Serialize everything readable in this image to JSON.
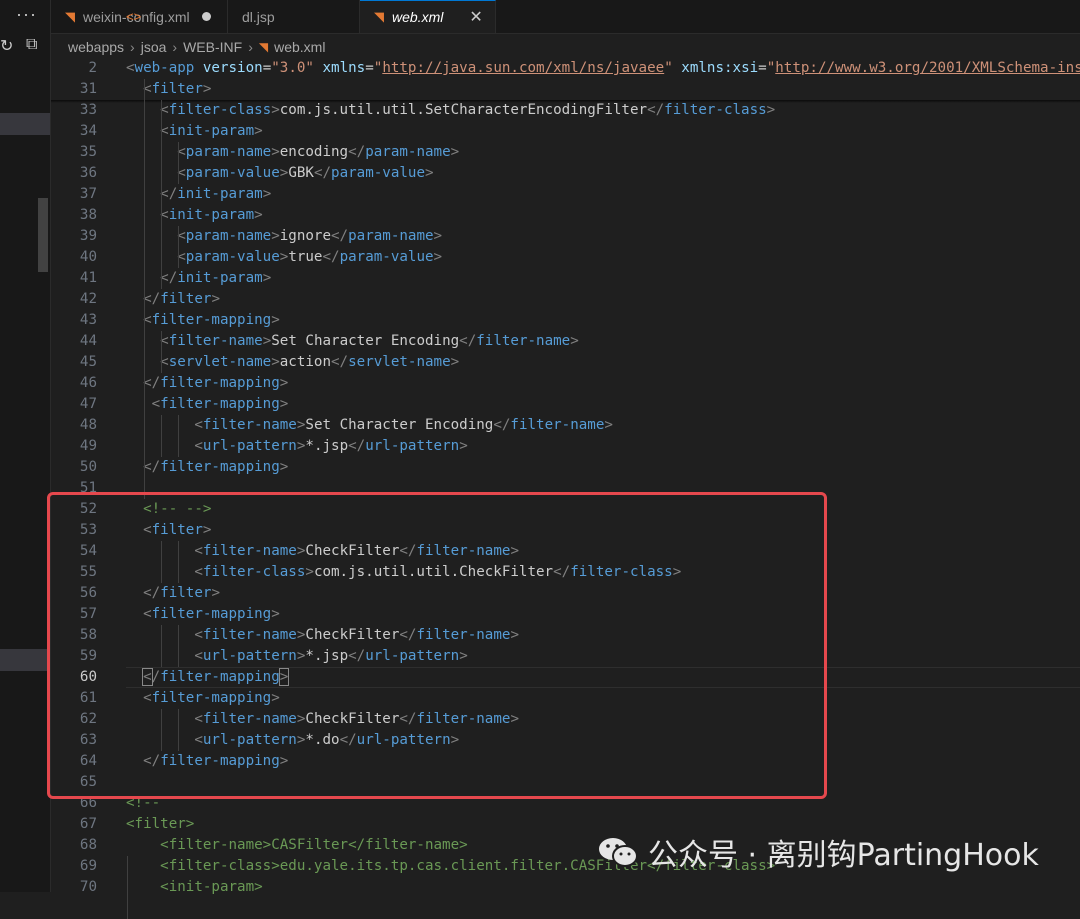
{
  "sidebar": {
    "more_icon": "ellipsis-icon",
    "refresh_icon": "refresh-icon",
    "collapse_icon": "collapse-all-icon"
  },
  "tabs": [
    {
      "label": "weixin-config.xml",
      "icon": "rss-icon",
      "modified": true,
      "active": false
    },
    {
      "label": "dl.jsp",
      "icon": "code-icon",
      "active": false
    },
    {
      "label": "web.xml",
      "icon": "rss-icon",
      "active": true
    }
  ],
  "breadcrumb": [
    "webapps",
    "jsoa",
    "WEB-INF",
    "web.xml"
  ],
  "current_line": "60",
  "watermark": "公众号 · 离别钩PartingHook",
  "lines": [
    {
      "n": "2",
      "html": "<span class='br'>&lt;</span><span class='t'>web-app</span> <span class='at'>version</span><span class='tx'>=</span><span class='st'>\"3.0\"</span> <span class='at'>xmlns</span><span class='tx'>=</span><span class='st'>\"<u>http://java.sun.com/xml/ns/javaee</u>\"</span> <span class='at'>xmlns:xsi</span><span class='tx'>=</span><span class='st'>\"<u>http://www.w3.org/2001/XMLSchema-ins</u></span>"
    },
    {
      "n": "31",
      "html": "  <span class='br'>&lt;</span><span class='t'>filter</span><span class='br'>&gt;</span>"
    },
    {
      "n": "33",
      "html": "    <span class='br'>&lt;</span><span class='t'>filter-class</span><span class='br'>&gt;</span><span class='tx'>com.js.util.util.SetCharacterEncodingFilter</span><span class='br'>&lt;/</span><span class='t'>filter-class</span><span class='br'>&gt;</span>"
    },
    {
      "n": "34",
      "html": "    <span class='br'>&lt;</span><span class='t'>init-param</span><span class='br'>&gt;</span>"
    },
    {
      "n": "35",
      "html": "      <span class='br'>&lt;</span><span class='t'>param-name</span><span class='br'>&gt;</span><span class='tx'>encoding</span><span class='br'>&lt;/</span><span class='t'>param-name</span><span class='br'>&gt;</span>"
    },
    {
      "n": "36",
      "html": "      <span class='br'>&lt;</span><span class='t'>param-value</span><span class='br'>&gt;</span><span class='tx'>GBK</span><span class='br'>&lt;/</span><span class='t'>param-value</span><span class='br'>&gt;</span>"
    },
    {
      "n": "37",
      "html": "    <span class='br'>&lt;/</span><span class='t'>init-param</span><span class='br'>&gt;</span>"
    },
    {
      "n": "38",
      "html": "    <span class='br'>&lt;</span><span class='t'>init-param</span><span class='br'>&gt;</span>"
    },
    {
      "n": "39",
      "html": "      <span class='br'>&lt;</span><span class='t'>param-name</span><span class='br'>&gt;</span><span class='tx'>ignore</span><span class='br'>&lt;/</span><span class='t'>param-name</span><span class='br'>&gt;</span>"
    },
    {
      "n": "40",
      "html": "      <span class='br'>&lt;</span><span class='t'>param-value</span><span class='br'>&gt;</span><span class='tx'>true</span><span class='br'>&lt;/</span><span class='t'>param-value</span><span class='br'>&gt;</span>"
    },
    {
      "n": "41",
      "html": "    <span class='br'>&lt;/</span><span class='t'>init-param</span><span class='br'>&gt;</span>"
    },
    {
      "n": "42",
      "html": "  <span class='br'>&lt;/</span><span class='t'>filter</span><span class='br'>&gt;</span>"
    },
    {
      "n": "43",
      "html": "  <span class='br'>&lt;</span><span class='t'>filter-mapping</span><span class='br'>&gt;</span>"
    },
    {
      "n": "44",
      "html": "    <span class='br'>&lt;</span><span class='t'>filter-name</span><span class='br'>&gt;</span><span class='tx'>Set Character Encoding</span><span class='br'>&lt;/</span><span class='t'>filter-name</span><span class='br'>&gt;</span>"
    },
    {
      "n": "45",
      "html": "    <span class='br'>&lt;</span><span class='t'>servlet-name</span><span class='br'>&gt;</span><span class='tx'>action</span><span class='br'>&lt;/</span><span class='t'>servlet-name</span><span class='br'>&gt;</span>"
    },
    {
      "n": "46",
      "html": "  <span class='br'>&lt;/</span><span class='t'>filter-mapping</span><span class='br'>&gt;</span>"
    },
    {
      "n": "47",
      "html": "   <span class='br'>&lt;</span><span class='t'>filter-mapping</span><span class='br'>&gt;</span>"
    },
    {
      "n": "48",
      "html": "        <span class='br'>&lt;</span><span class='t'>filter-name</span><span class='br'>&gt;</span><span class='tx'>Set Character Encoding</span><span class='br'>&lt;/</span><span class='t'>filter-name</span><span class='br'>&gt;</span>"
    },
    {
      "n": "49",
      "html": "        <span class='br'>&lt;</span><span class='t'>url-pattern</span><span class='br'>&gt;</span><span class='tx'>*.jsp</span><span class='br'>&lt;/</span><span class='t'>url-pattern</span><span class='br'>&gt;</span>"
    },
    {
      "n": "50",
      "html": "  <span class='br'>&lt;/</span><span class='t'>filter-mapping</span><span class='br'>&gt;</span>"
    },
    {
      "n": "51",
      "html": ""
    },
    {
      "n": "52",
      "html": "  <span class='cm'>&lt;!-- --&gt;</span>"
    },
    {
      "n": "53",
      "html": "  <span class='br'>&lt;</span><span class='t'>filter</span><span class='br'>&gt;</span>"
    },
    {
      "n": "54",
      "html": "        <span class='br'>&lt;</span><span class='t'>filter-name</span><span class='br'>&gt;</span><span class='tx'>CheckFilter</span><span class='br'>&lt;/</span><span class='t'>filter-name</span><span class='br'>&gt;</span>"
    },
    {
      "n": "55",
      "html": "        <span class='br'>&lt;</span><span class='t'>filter-class</span><span class='br'>&gt;</span><span class='tx'>com.js.util.util.CheckFilter</span><span class='br'>&lt;/</span><span class='t'>filter-class</span><span class='br'>&gt;</span>"
    },
    {
      "n": "56",
      "html": "  <span class='br'>&lt;/</span><span class='t'>filter</span><span class='br'>&gt;</span>"
    },
    {
      "n": "57",
      "html": "  <span class='br'>&lt;</span><span class='t'>filter-mapping</span><span class='br'>&gt;</span>"
    },
    {
      "n": "58",
      "html": "        <span class='br'>&lt;</span><span class='t'>filter-name</span><span class='br'>&gt;</span><span class='tx'>CheckFilter</span><span class='br'>&lt;/</span><span class='t'>filter-name</span><span class='br'>&gt;</span>"
    },
    {
      "n": "59",
      "html": "        <span class='br'>&lt;</span><span class='t'>url-pattern</span><span class='br'>&gt;</span><span class='tx'>*.jsp</span><span class='br'>&lt;/</span><span class='t'>url-pattern</span><span class='br'>&gt;</span>"
    },
    {
      "n": "60",
      "html": "  <span class='br bracket-box'>&lt;</span><span class='br'>/</span><span class='t'>filter-mapping</span><span class='br bracket-box'>&gt;</span>"
    },
    {
      "n": "61",
      "html": "  <span class='br'>&lt;</span><span class='t'>filter-mapping</span><span class='br'>&gt;</span>"
    },
    {
      "n": "62",
      "html": "        <span class='br'>&lt;</span><span class='t'>filter-name</span><span class='br'>&gt;</span><span class='tx'>CheckFilter</span><span class='br'>&lt;/</span><span class='t'>filter-name</span><span class='br'>&gt;</span>"
    },
    {
      "n": "63",
      "html": "        <span class='br'>&lt;</span><span class='t'>url-pattern</span><span class='br'>&gt;</span><span class='tx'>*.do</span><span class='br'>&lt;/</span><span class='t'>url-pattern</span><span class='br'>&gt;</span>"
    },
    {
      "n": "64",
      "html": "  <span class='br'>&lt;/</span><span class='t'>filter-mapping</span><span class='br'>&gt;</span>"
    },
    {
      "n": "65",
      "html": ""
    },
    {
      "n": "66",
      "html": "<span class='cm'>&lt;!--</span>"
    },
    {
      "n": "67",
      "html": "<span class='cm'>&lt;filter&gt;</span>"
    },
    {
      "n": "68",
      "html": "    <span class='cm'>&lt;filter-name&gt;CASFilter&lt;/filter-name&gt;</span>"
    },
    {
      "n": "69",
      "html": "    <span class='cm'>&lt;filter-class&gt;edu.yale.its.tp.cas.client.filter.CASFilter&lt;/filter-class&gt;</span>"
    },
    {
      "n": "70",
      "html": "    <span class='cm'>&lt;init-param&gt;</span>"
    }
  ]
}
